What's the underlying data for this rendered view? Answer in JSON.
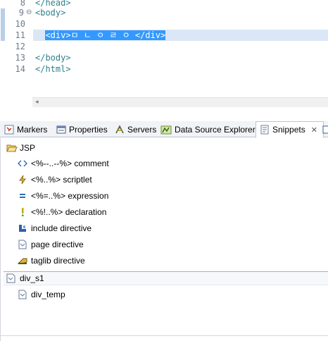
{
  "editor": {
    "lines": [
      {
        "num": "8",
        "code": "</head>"
      },
      {
        "num": "9",
        "code": "<body>",
        "fold": "⊖"
      },
      {
        "num": "10",
        "code": ""
      },
      {
        "num": "11",
        "code_prefix": "  ",
        "code_selected": "<div>ㅁ ㄴ ㅇ ㄹ ㅇ </div>"
      },
      {
        "num": "12",
        "code": ""
      },
      {
        "num": "13",
        "code": "</body>"
      },
      {
        "num": "14",
        "code": "</html>"
      }
    ],
    "scroll_left_glyph": "◂"
  },
  "tabs": [
    {
      "label": "Markers",
      "icon": "markers-icon"
    },
    {
      "label": "Properties",
      "icon": "properties-icon"
    },
    {
      "label": "Servers",
      "icon": "servers-icon"
    },
    {
      "label": "Data Source Explorer",
      "icon": "data-source-explorer-icon"
    },
    {
      "label": "Snippets",
      "icon": "snippets-icon",
      "active": true,
      "close": "✕"
    }
  ],
  "snippets": {
    "drawers": [
      {
        "label": "JSP",
        "items": [
          {
            "label": "<%--..--%> comment",
            "icon": "comment-icon"
          },
          {
            "label": "<%..%> scriptlet",
            "icon": "scriptlet-icon"
          },
          {
            "label": "<%=..%> expression",
            "icon": "expression-icon"
          },
          {
            "label": "<%!..%> declaration",
            "icon": "declaration-icon"
          },
          {
            "label": "include directive",
            "icon": "include-icon"
          },
          {
            "label": "page directive",
            "icon": "page-icon"
          },
          {
            "label": "taglib directive",
            "icon": "taglib-icon"
          }
        ]
      },
      {
        "label": "div_s1",
        "items": [
          {
            "label": "div_temp",
            "icon": "template-icon"
          }
        ]
      }
    ]
  },
  "colors": {
    "code_teal": "#2f7f8e",
    "selection": "#3399ff",
    "current_line": "#dbe7f6",
    "line_number": "#6f7a8a"
  }
}
